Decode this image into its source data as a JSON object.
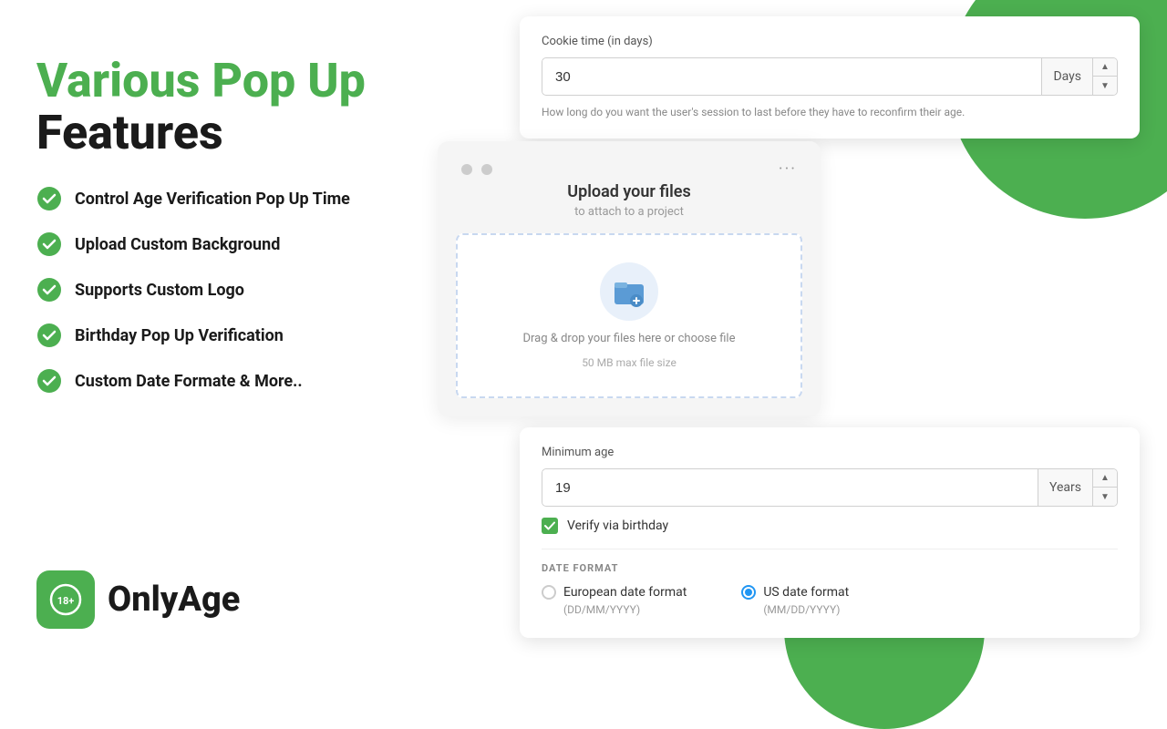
{
  "page": {
    "title": "Various Pop Up Features"
  },
  "heading": {
    "line1": "Various Pop Up",
    "line2": "Features"
  },
  "features": [
    {
      "id": 1,
      "text": "Control Age Verification Pop Up Time"
    },
    {
      "id": 2,
      "text": "Upload Custom Background"
    },
    {
      "id": 3,
      "text": "Supports Custom Logo"
    },
    {
      "id": 4,
      "text": "Birthday Pop Up Verification"
    },
    {
      "id": 5,
      "text": "Custom Date Formate & More.."
    }
  ],
  "logo": {
    "name": "OnlyAge",
    "badge_text": "18+"
  },
  "cookie_card": {
    "label": "Cookie time (in days)",
    "value": "30",
    "unit": "Days",
    "hint": "How long do you want the user's session to last before they have to reconfirm their age."
  },
  "upload_card": {
    "title": "Upload your files",
    "subtitle": "to attach to a project",
    "drop_text": "Drag & drop your files here or choose file",
    "size_limit": "50 MB max file size"
  },
  "age_card": {
    "label": "Minimum age",
    "value": "19",
    "unit": "Years",
    "checkbox_label": "Verify via birthday",
    "date_format_title": "DATE FORMAT",
    "option1_label": "European date format",
    "option1_sub": "(DD/MM/YYYY)",
    "option2_label": "US date format",
    "option2_sub": "(MM/DD/YYYY)"
  },
  "colors": {
    "green": "#4CAF50",
    "dark": "#1a1a1a",
    "blue": "#2196F3"
  }
}
